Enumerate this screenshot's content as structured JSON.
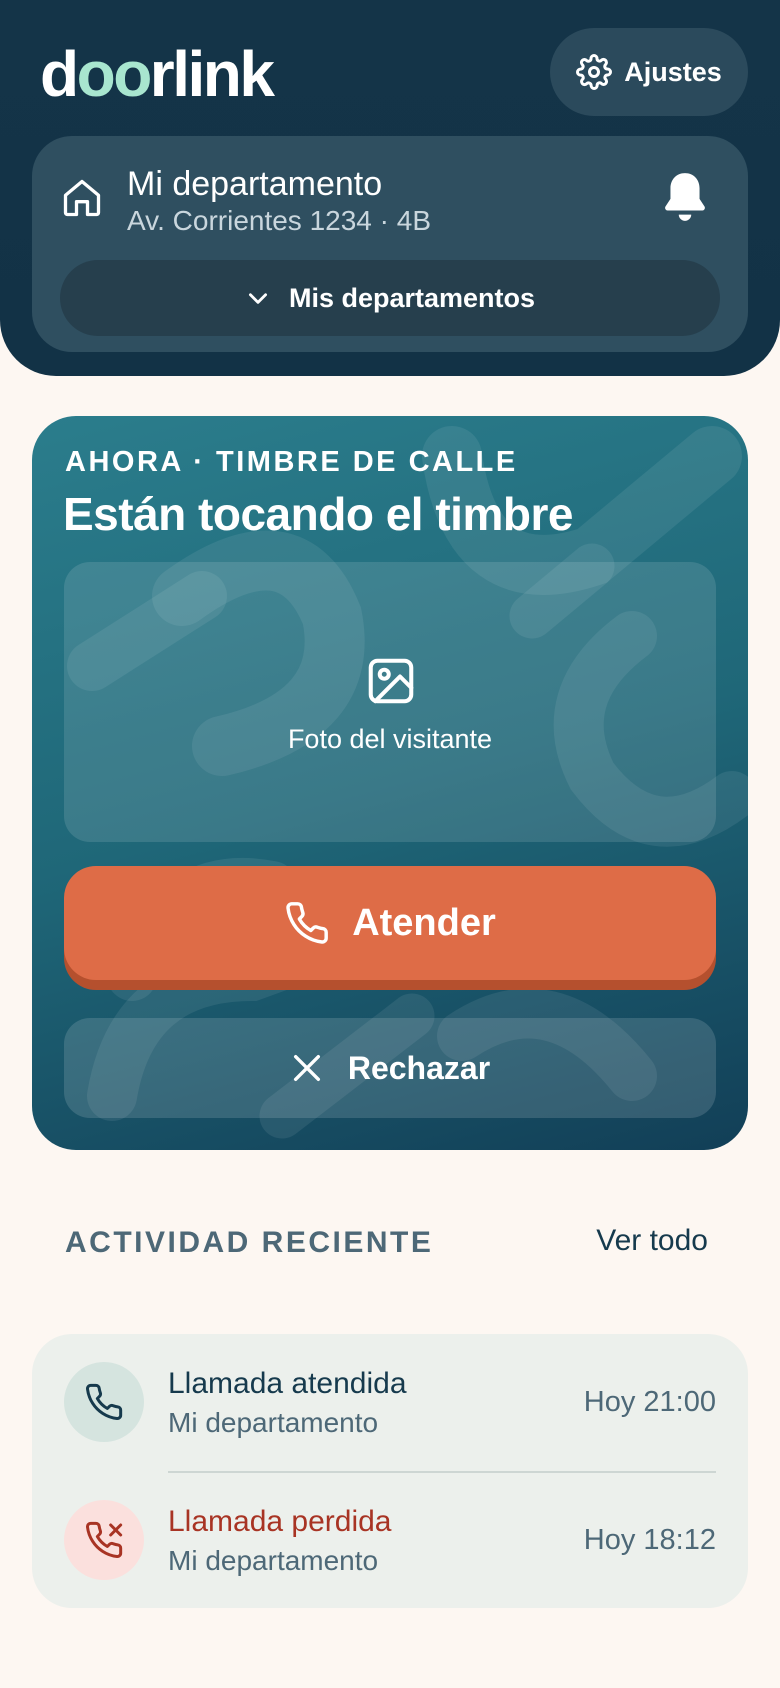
{
  "header": {
    "logo": {
      "part1": "d",
      "accent": "oo",
      "part2": "rlink"
    },
    "settings_label": "Ajustes",
    "apartment": {
      "name": "Mi departamento",
      "address": "Av. Corrientes 1234 · 4B"
    },
    "apartments_dropdown_label": "Mis departamentos"
  },
  "ring": {
    "eyebrow": "AHORA · TIMBRE DE CALLE",
    "title": "Están tocando el timbre",
    "photo_label": "Foto del visitante",
    "answer_label": "Atender",
    "reject_label": "Rechazar"
  },
  "activity": {
    "section_title": "ACTIVIDAD RECIENTE",
    "see_all_label": "Ver todo",
    "items": [
      {
        "title": "Llamada atendida",
        "subtitle": "Mi departamento",
        "time": "Hoy 21:00",
        "status": "answered",
        "icon": "phone-icon"
      },
      {
        "title": "Llamada perdida",
        "subtitle": "Mi departamento",
        "time": "Hoy 18:12",
        "status": "missed",
        "icon": "phone-missed-icon"
      }
    ]
  },
  "colors": {
    "header_bg": "#143448",
    "logo_accent": "#a8e6cf",
    "answer_button": "#de6c47",
    "missed_red": "#a83424",
    "page_bg": "#fdf7f2"
  }
}
